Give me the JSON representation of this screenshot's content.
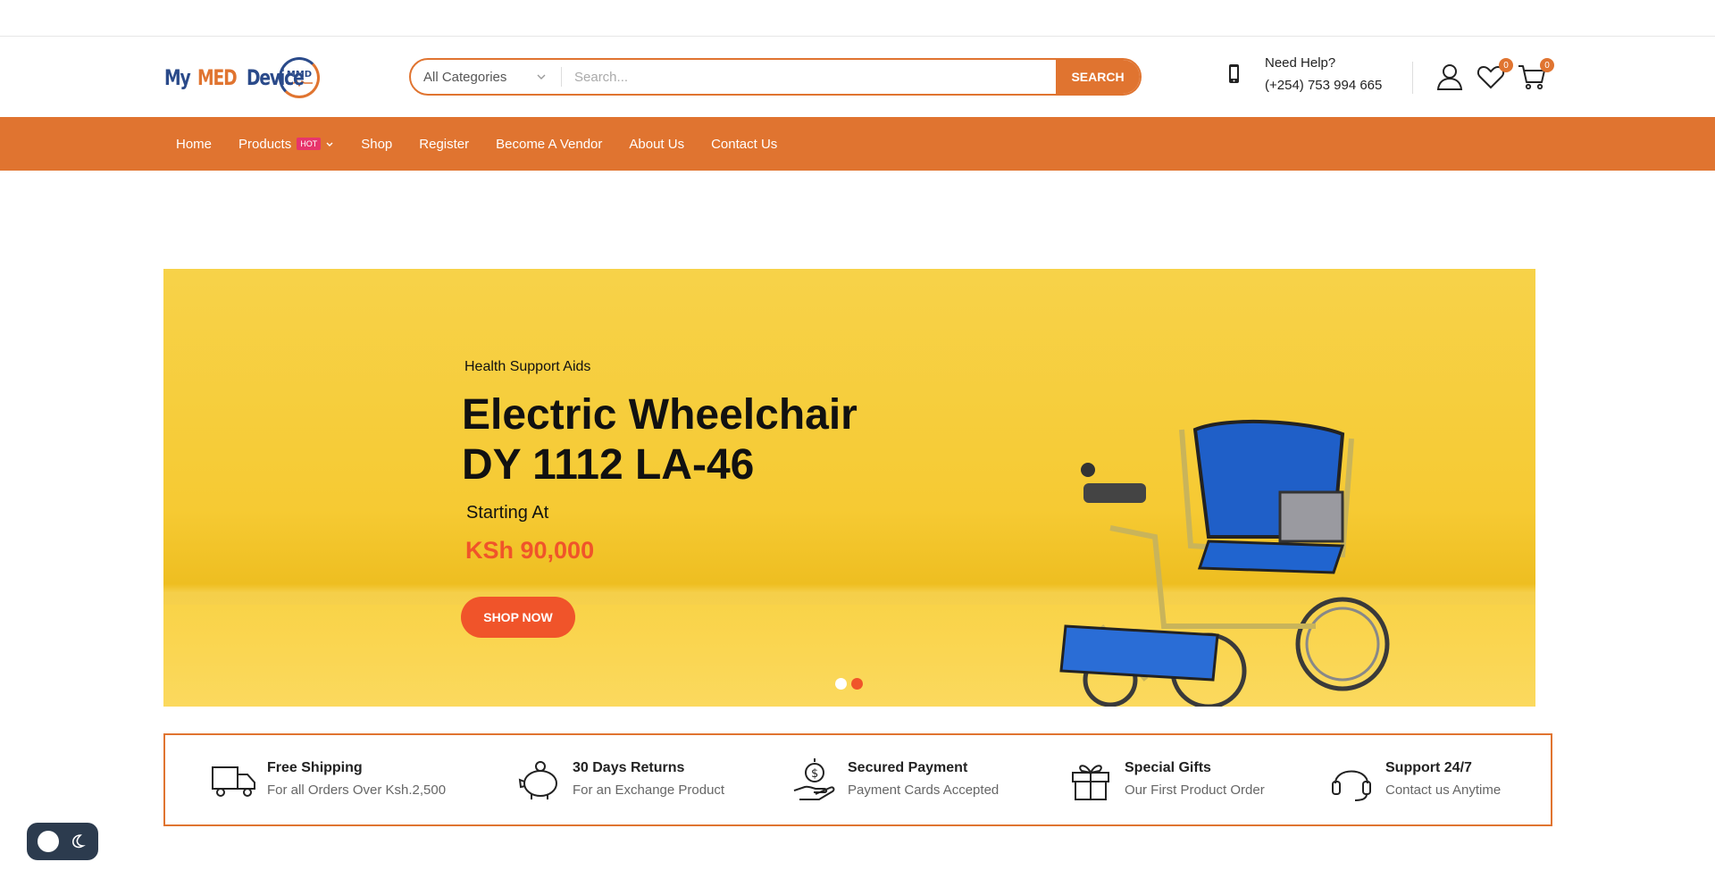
{
  "header": {
    "logo": {
      "word_my": "My",
      "word_med": "MED",
      "word_device": "Device",
      "badge": "MMD"
    },
    "search": {
      "category": "All Categories",
      "placeholder": "Search...",
      "button": "SEARCH"
    },
    "help": {
      "title": "Need Help?",
      "phone": "(+254) 753 994 665"
    },
    "wishlist_count": "0",
    "cart_count": "0"
  },
  "nav": {
    "items": [
      {
        "label": "Home"
      },
      {
        "label": "Products",
        "badge": "HOT"
      },
      {
        "label": "Shop"
      },
      {
        "label": "Register"
      },
      {
        "label": "Become A Vendor"
      },
      {
        "label": "About Us"
      },
      {
        "label": "Contact Us"
      }
    ]
  },
  "hero": {
    "subtitle": "Health Support Aids",
    "title_line1": "Electric Wheelchair",
    "title_line2": "DY 1112 LA-46",
    "starting": "Starting At",
    "price": "KSh 90,000",
    "cta": "SHOP NOW",
    "slides": 2,
    "active_slide": 2
  },
  "features": [
    {
      "icon": "truck-icon",
      "title": "Free Shipping",
      "desc": "For all Orders Over Ksh.2,500"
    },
    {
      "icon": "piggy-bank-icon",
      "title": "30 Days Returns",
      "desc": "For an Exchange Product"
    },
    {
      "icon": "payment-hand-icon",
      "title": "Secured Payment",
      "desc": "Payment Cards Accepted"
    },
    {
      "icon": "gift-icon",
      "title": "Special Gifts",
      "desc": "Our First Product Order"
    },
    {
      "icon": "headset-icon",
      "title": "Support 24/7",
      "desc": "Contact us Anytime"
    }
  ],
  "colors": {
    "accent": "#e07430",
    "cta": "#f0542a",
    "hot_badge": "#e7356c",
    "hero_bg": "#f6ca33",
    "toggle_bg": "#2c3b4e"
  }
}
